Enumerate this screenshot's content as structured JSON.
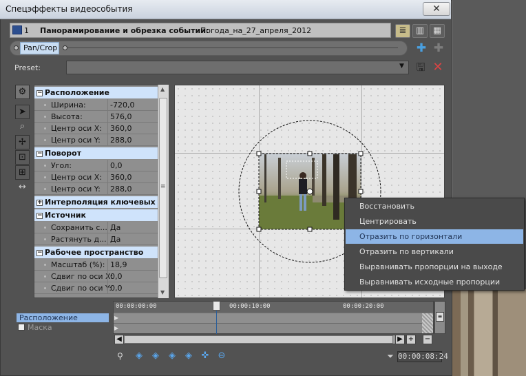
{
  "window": {
    "title": "Спецэффекты видеособытия",
    "close_glyph": "✕"
  },
  "header": {
    "chain_index": "1",
    "title": "Панорамирование и обрезка событий:",
    "event_name": "Погода_на_27_апреля_2012"
  },
  "chain": {
    "plugin_label": "Pan/Crop"
  },
  "preset": {
    "label": "Preset:",
    "value": ""
  },
  "properties": {
    "sections": [
      {
        "title": "Расположение",
        "rows": [
          {
            "label": "Ширина:",
            "value": "-720,0"
          },
          {
            "label": "Высота:",
            "value": "576,0"
          },
          {
            "label": "Центр оси X:",
            "value": "360,0"
          },
          {
            "label": "Центр оси Y:",
            "value": "288,0"
          }
        ]
      },
      {
        "title": "Поворот",
        "rows": [
          {
            "label": "Угол:",
            "value": "0,0"
          },
          {
            "label": "Центр оси X:",
            "value": "360,0"
          },
          {
            "label": "Центр оси Y:",
            "value": "288,0"
          }
        ]
      },
      {
        "title": "Интерполяция ключевых ...",
        "rows": []
      },
      {
        "title": "Источник",
        "rows": [
          {
            "label": "Сохранить с...",
            "value": "Да"
          },
          {
            "label": "Растянуть д...",
            "value": "Да"
          }
        ]
      },
      {
        "title": "Рабочее пространство",
        "rows": [
          {
            "label": "Масштаб (%):",
            "value": "18,9"
          },
          {
            "label": "Сдвиг по оси X:",
            "value": "0,0"
          },
          {
            "label": "Сдвиг по оси Y:",
            "value": "0,0"
          }
        ]
      }
    ]
  },
  "context_menu": {
    "items": [
      "Восстановить",
      "Центрировать",
      "Отразить по горизонтали",
      "Отразить по вертикали",
      "Выравнивать пропорции на выходе",
      "Выравнивать исходные пропорции"
    ],
    "highlighted_index": 2
  },
  "timeline": {
    "tracks": [
      "Расположение",
      "Маска"
    ],
    "ruler_labels": [
      "00:00:00:00",
      "00:00:10:00",
      "00:00:20:00"
    ],
    "time_display": "00:00:08:24"
  },
  "colors": {
    "highlight": "#8db5e6",
    "section_header": "#cfe3fb"
  }
}
